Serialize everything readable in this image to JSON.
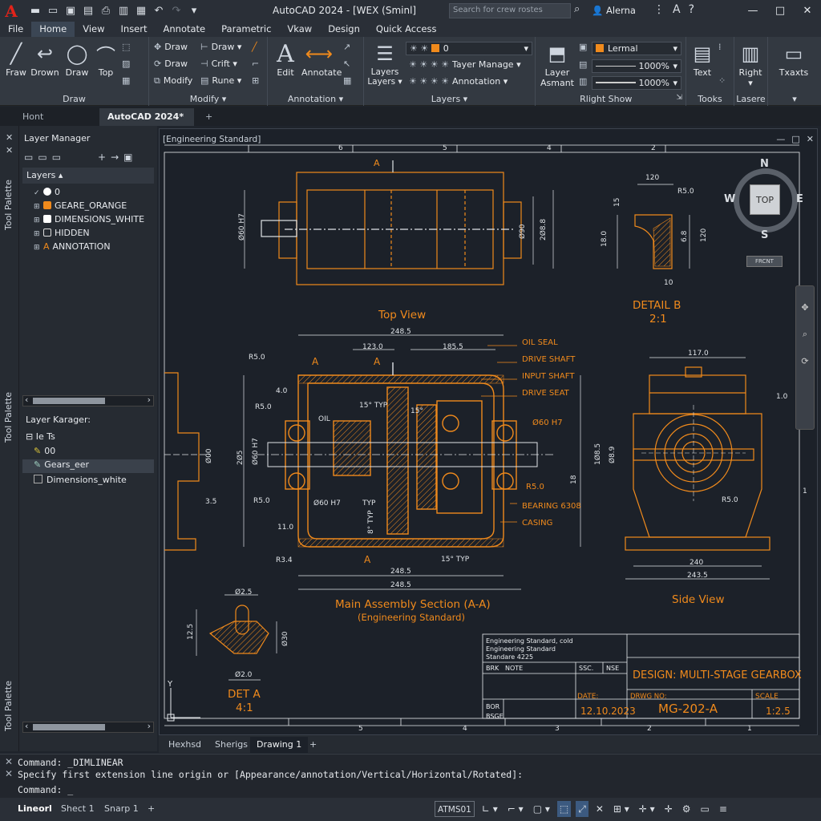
{
  "window": {
    "title": "AutoCAD 2024 - [WEX (Sminl]",
    "search_placeholder": "Search for crew rostes",
    "user": "Alerna",
    "font_glyph": "A"
  },
  "menu": [
    "File",
    "Home",
    "View",
    "Insert",
    "Annotate",
    "Parametric",
    "Vkaw",
    "Design",
    "Quick Access"
  ],
  "ribbon": {
    "draw_panel": {
      "title": "Draw",
      "big_buttons": [
        "Fraw",
        "Drown",
        "Draw",
        "Top"
      ],
      "small": [
        "Draw",
        "Draw",
        "Modify"
      ]
    },
    "modify_panel": {
      "title": "Modify",
      "small": [
        "Draw",
        "Crift",
        "Rune"
      ]
    },
    "annotation_panel": {
      "title": "Annotation",
      "big_buttons": [
        "Edit",
        "Annotate"
      ]
    },
    "layers_panel": {
      "title": "Layers",
      "big_label_1": "Layers",
      "big_label_2": "Layers",
      "combo_value": "0",
      "small": [
        "Tayer Manage",
        "Annotation"
      ]
    },
    "rlight_panel": {
      "title": "Rlight Show",
      "layer_label_1": "Layer",
      "layer_label_2": "Asmant",
      "combo_value": "Lermal",
      "scale1": "1000%",
      "scale2": "1000%"
    },
    "tools_panel": {
      "title": "Tooks",
      "text": "Text"
    },
    "lasere_panel": {
      "title": "Lasere",
      "right": "Right"
    },
    "extra_panel": {
      "label": "Txaxts"
    }
  },
  "doc_tabs": [
    "Hont",
    "AutoCAD 2024*"
  ],
  "palette_labels": [
    "Tool Palette",
    "Tool Palette",
    "Tool Palette"
  ],
  "layer_manager": {
    "title": "Layer Manager",
    "header": "Layers",
    "layers": [
      {
        "name": "0",
        "color": "#ffffff"
      },
      {
        "name": "GEARE_ORANGE",
        "color": "#f08a1c"
      },
      {
        "name": "DIMENSIONS_WHITE",
        "color": "#ffffff"
      },
      {
        "name": "HIDDEN",
        "color": "#e6e9ed"
      },
      {
        "name": "ANNOTATION",
        "color": "#f08a1c"
      }
    ],
    "lower_title": "Layer Karager:",
    "lower_header": "Ie Ts",
    "lower_items": [
      "00",
      "Gears_eer",
      "Dimensions_white"
    ]
  },
  "viewport": {
    "label": "[Engineering Standard]",
    "viewcube": {
      "top": "TOP",
      "n": "N",
      "s": "S",
      "e": "E",
      "w": "W",
      "front": "FRCNT"
    }
  },
  "drawing": {
    "ruler_top": [
      "6",
      "5",
      "4",
      "3",
      "2",
      "1"
    ],
    "ruler_bottom": [
      "5",
      "4",
      "3",
      "2",
      "1"
    ],
    "views": {
      "top": "Top View",
      "detail_b": "DETAIL B",
      "detail_b_scale": "2:1",
      "main": "Main Assembly Section (A-A)",
      "main_sub": "(Engineering Standard)",
      "side": "Side View",
      "det_a": "DET A",
      "det_a_scale": "4:1"
    },
    "callouts": [
      "OIL SEAL",
      "DRIVE SHAFT",
      "INPUT SHAFT",
      "DRIVE SEAT",
      "Ø60 H7",
      "R5.0",
      "BEARING 6308",
      "CASING"
    ],
    "dims": {
      "top_h": "Ø60 H7",
      "top_r1": "Ø90",
      "top_r2": "2Ø8.8",
      "detail_120": "120",
      "detail_r5": "R5.0",
      "detail_15": "15",
      "detail_180": "18.0",
      "detail_68": "6.8",
      "detail_120v": "120",
      "detail_10": "10",
      "main_2485": "248.5",
      "main_1230": "123.0",
      "main_1855": "185.5",
      "main_r50": "R5.0",
      "main_40": "4.0",
      "main_r50b": "R5.0",
      "main_oil": "OIL",
      "main_15typ": "15° TYP",
      "main_15": "15°",
      "main_60h7": "Ø60 H7",
      "main_2405": "2Ø5",
      "main_r50c": "R5.0",
      "main_60h7b": "Ø60 H7",
      "main_typ": "TYP",
      "main_8typ": "8° TYP",
      "main_110": "11.0",
      "main_r34": "R3.4",
      "main_2485b": "248.5",
      "main_2485c": "248.5",
      "main_15typb": "15° TYP",
      "main_a": "A",
      "main_18": "18",
      "left_00": "Ø00",
      "left_35": "3.5",
      "side_1170": "117.0",
      "side_10": "1.0",
      "side_1885": "1Ø8.5",
      "side_689": "Ø8.9",
      "side_r50": "R5.0",
      "side_240": "240",
      "side_2435": "243.5",
      "deta_25": "Ø2.5",
      "deta_125": "12.5",
      "deta_030": "Ø30",
      "deta_820": "Ø2.0"
    },
    "titleblock": {
      "std1": "Engineering Standard, cold",
      "std2": "Engineering Standard",
      "std3": "Standare 4225",
      "brk": "BRK",
      "note": "NOTE",
      "ssc": "SSC.",
      "nse": "NSE",
      "design": "DESIGN: MULTI-STAGE GEARBOX",
      "date_label": "DATE:",
      "date": "12.10.2023",
      "dwg_label": "DRWG NO:",
      "dwg": "MG-202-A",
      "scale_label": "SCALE",
      "scale": "1:2.5",
      "bor": "BOR",
      "bsge": "BSGE"
    }
  },
  "layout_tabs": [
    "Hexhsd",
    "Sherigs",
    "Drawing 1"
  ],
  "command": {
    "line1": "Command: _DIMLINEAR",
    "line2": "Specify first extension line origin or [Appearance/annotation/Vertical/Horizontal/Rotated]:",
    "line3": "Command: _"
  },
  "status": {
    "tabs": [
      "Lineorl",
      "Shect 1",
      "Snarp 1"
    ],
    "coord": "ATMS01"
  },
  "colors": {
    "orange": "#f08a1c",
    "bg": "#1c2129",
    "accent": "#3c5a80"
  }
}
